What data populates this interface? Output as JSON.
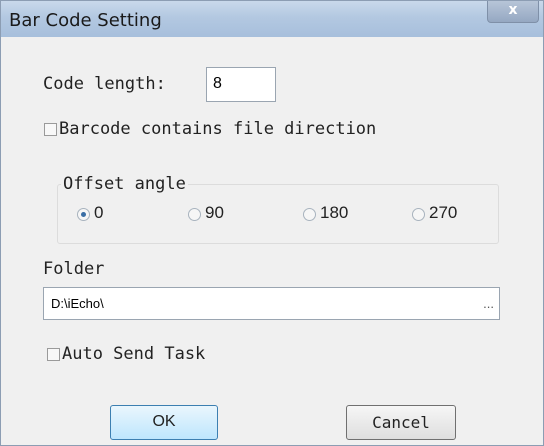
{
  "window": {
    "title": "Bar Code Setting",
    "close_glyph": "x"
  },
  "code_length": {
    "label": "Code length:",
    "value": "8"
  },
  "direction_checkbox": {
    "label": "Barcode contains file direction",
    "checked": false
  },
  "offset_angle": {
    "legend": "Offset angle",
    "options": [
      "0",
      "90",
      "180",
      "270"
    ],
    "selected": "0"
  },
  "folder": {
    "label": "Folder",
    "value": "D:\\iEcho\\",
    "browse_label": "..."
  },
  "auto_send": {
    "label": "Auto Send Task",
    "checked": false
  },
  "buttons": {
    "ok": "OK",
    "cancel": "Cancel"
  }
}
